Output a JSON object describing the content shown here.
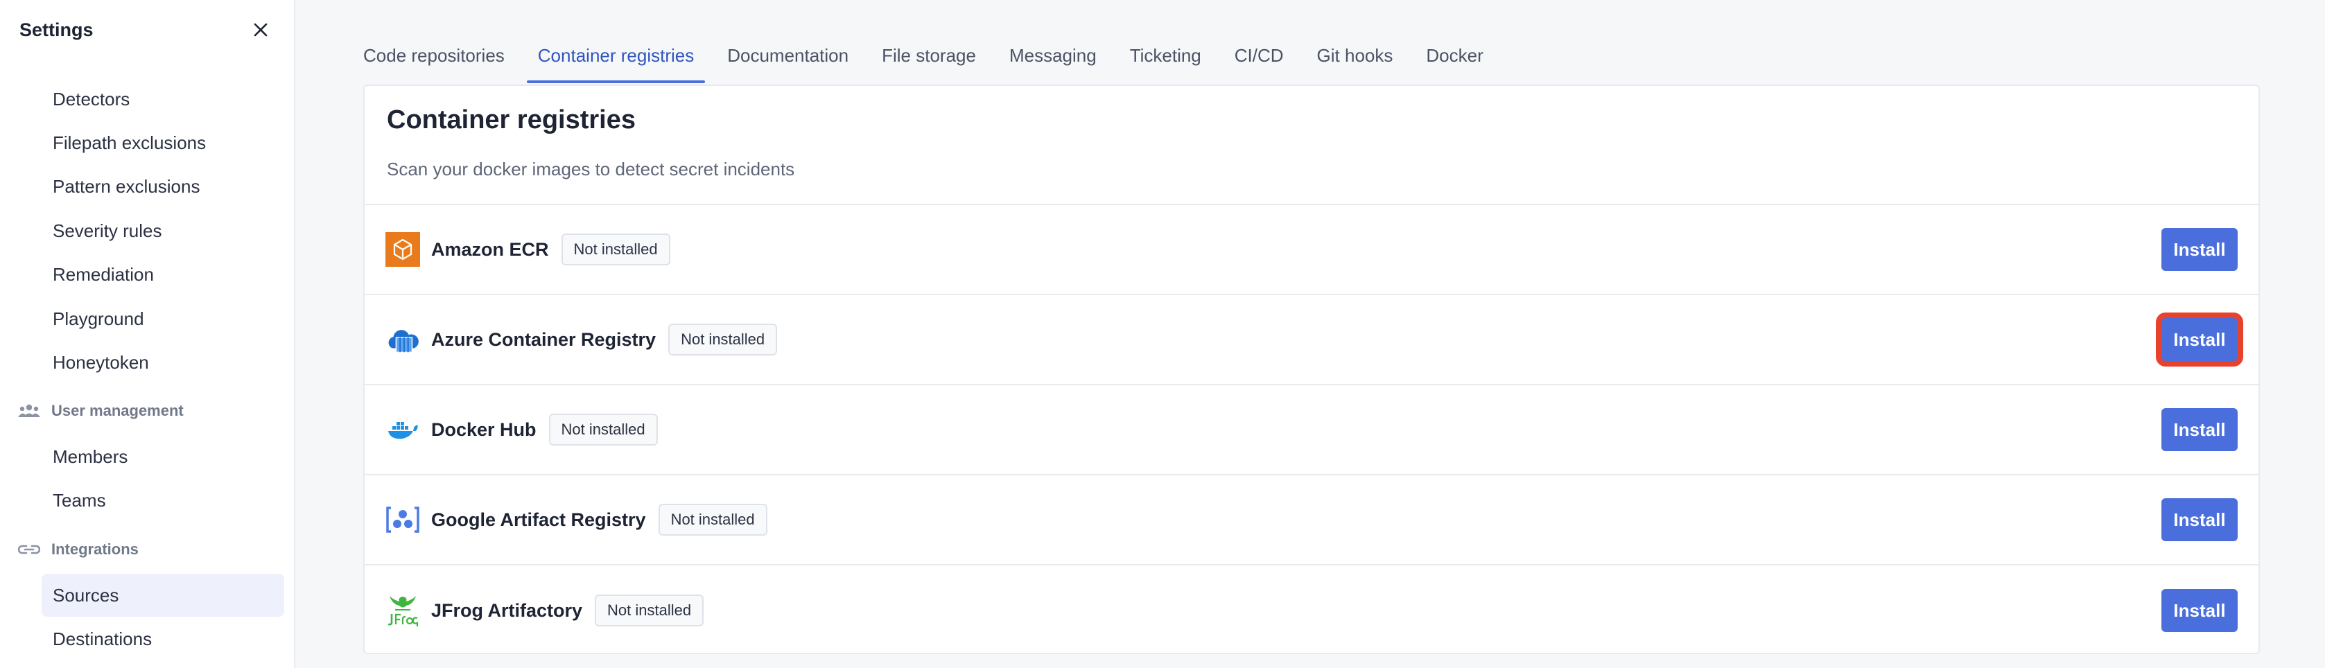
{
  "sidebar": {
    "title": "Settings",
    "items_top": [
      "Detectors",
      "Filepath exclusions",
      "Pattern exclusions",
      "Severity rules",
      "Remediation",
      "Playground",
      "Honeytoken"
    ],
    "section_user": "User management",
    "items_user": [
      "Members",
      "Teams"
    ],
    "section_integrations": "Integrations",
    "items_integrations": [
      "Sources",
      "Destinations"
    ],
    "active_item": "Sources"
  },
  "tabs": [
    "Code repositories",
    "Container registries",
    "Documentation",
    "File storage",
    "Messaging",
    "Ticketing",
    "CI/CD",
    "Git hooks",
    "Docker"
  ],
  "active_tab": "Container registries",
  "card": {
    "title": "Container registries",
    "subtitle": "Scan your docker images to detect secret incidents",
    "rows": [
      {
        "name": "Amazon ECR",
        "status": "Not installed",
        "action": "Install",
        "icon": "amazon-ecr-icon"
      },
      {
        "name": "Azure Container Registry",
        "status": "Not installed",
        "action": "Install",
        "icon": "azure-container-registry-icon"
      },
      {
        "name": "Docker Hub",
        "status": "Not installed",
        "action": "Install",
        "icon": "docker-hub-icon"
      },
      {
        "name": "Google Artifact Registry",
        "status": "Not installed",
        "action": "Install",
        "icon": "google-artifact-registry-icon"
      },
      {
        "name": "JFrog Artifactory",
        "status": "Not installed",
        "action": "Install",
        "icon": "jfrog-artifactory-icon"
      }
    ]
  },
  "colors": {
    "accent": "#4a6fdc",
    "active_tab_text": "#2f55c0",
    "highlight_outline": "#e8422c",
    "active_nav_bg": "#eef0fb"
  },
  "icons": {
    "close": "close-icon",
    "user_management": "users-icon",
    "integrations": "integrations-icon"
  }
}
